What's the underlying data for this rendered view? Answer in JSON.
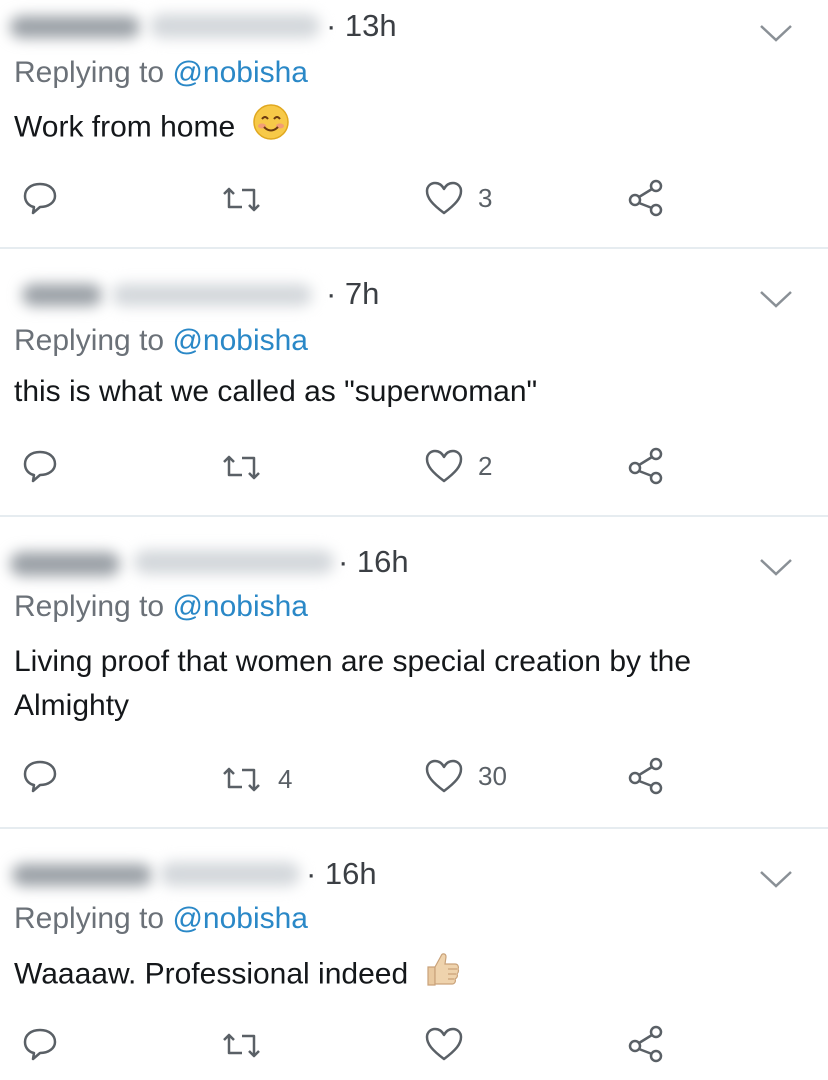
{
  "tweets": [
    {
      "time": "· 13h",
      "replying_prefix": "Replying to",
      "replying_handle": "@nobisha",
      "text": "Work from home",
      "emoji": "smiling-face-icon",
      "replies": "",
      "retweets": "",
      "likes": "3"
    },
    {
      "time": "· 7h",
      "replying_prefix": "Replying to",
      "replying_handle": "@nobisha",
      "text": "this is what we called as \"superwoman\"",
      "emoji": "",
      "replies": "",
      "retweets": "",
      "likes": "2"
    },
    {
      "time": "· 16h",
      "replying_prefix": "Replying to",
      "replying_handle": "@nobisha",
      "text": "Living proof that women are special creation by the Almighty",
      "emoji": "",
      "replies": "",
      "retweets": "4",
      "likes": "30"
    },
    {
      "time": "· 16h",
      "replying_prefix": "Replying to",
      "replying_handle": "@nobisha",
      "text": "Waaaaw. Professional indeed",
      "emoji": "thumbs-up-icon",
      "replies": "",
      "retweets": "",
      "likes": ""
    }
  ],
  "colors": {
    "handle": "#2a88c7",
    "secondary_text": "#6b7178",
    "icon": "#5a6066",
    "divider": "#e6ecf0",
    "blurred_name": "#9aa0a6"
  }
}
